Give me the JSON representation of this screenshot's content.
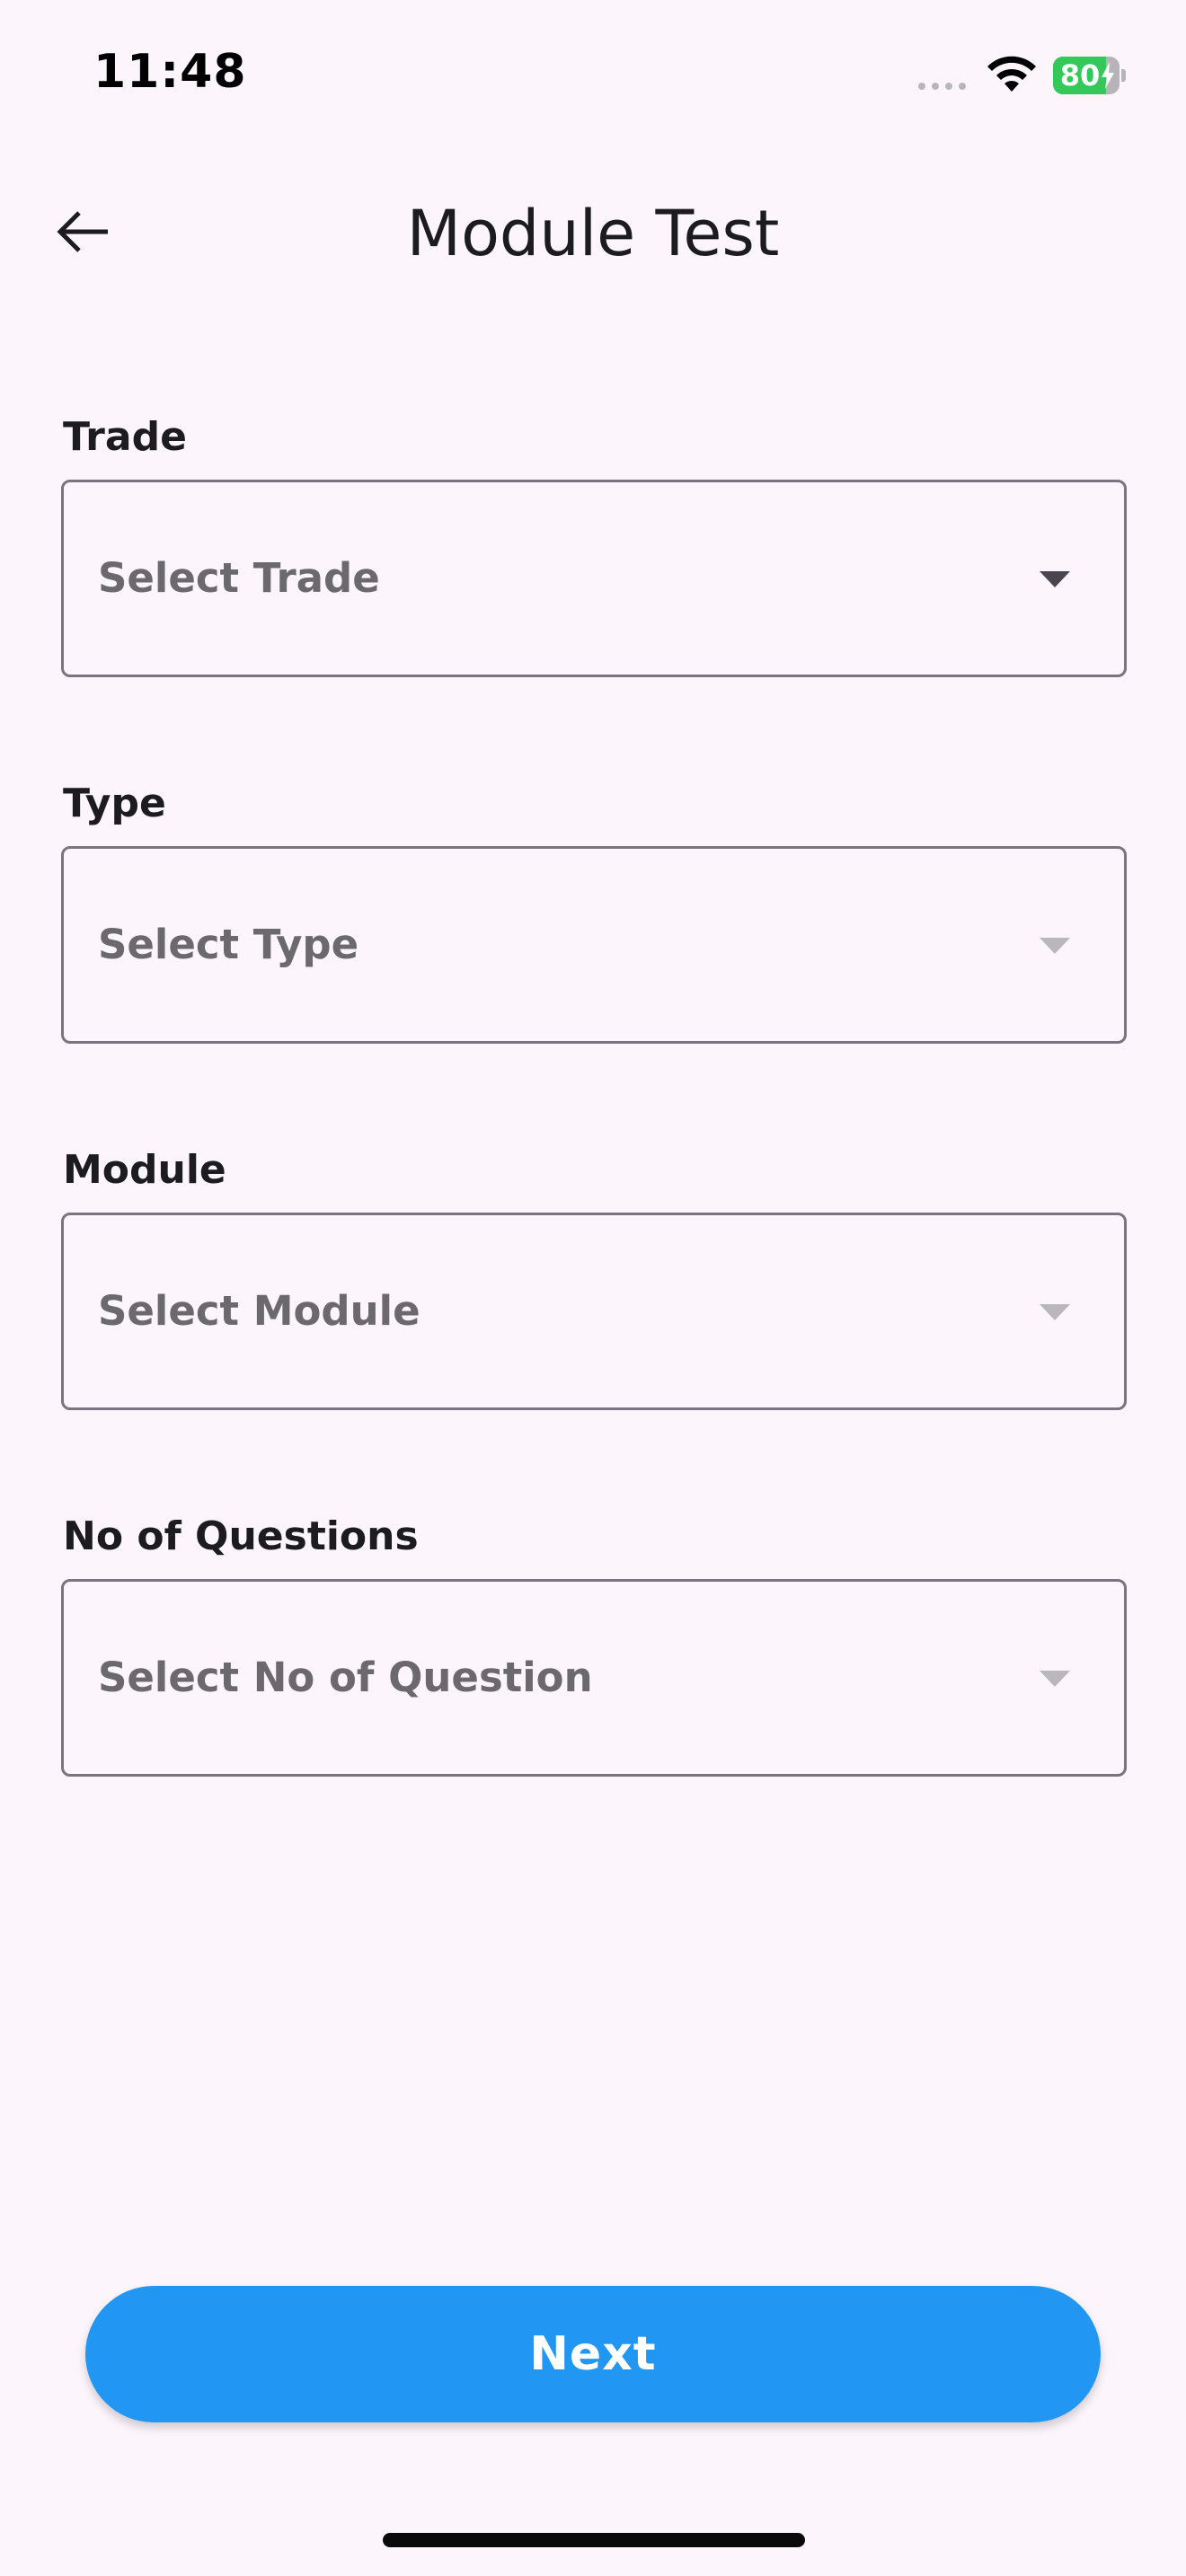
{
  "status_bar": {
    "time": "11:48",
    "battery_percent": "80",
    "battery_level": 0.8,
    "battery_color": "#34C759"
  },
  "app_bar": {
    "title": "Module Test",
    "back_icon": "arrow-back-icon"
  },
  "form": {
    "fields": [
      {
        "label": "Trade",
        "placeholder": "Select Trade",
        "enabled": true
      },
      {
        "label": "Type",
        "placeholder": "Select Type",
        "enabled": false
      },
      {
        "label": "Module",
        "placeholder": "Select Module",
        "enabled": false
      },
      {
        "label": "No of Questions",
        "placeholder": "Select No of Question",
        "enabled": false
      }
    ],
    "dropdown_icon": "arrow-drop-down-icon"
  },
  "actions": {
    "next_label": "Next",
    "next_color": "#2196F3"
  },
  "colors": {
    "background": "#FCF6FC",
    "outline": "#79747E",
    "placeholder_text": "#6B696E",
    "arrow_enabled": "#49454F",
    "arrow_disabled": "#B9B6BC"
  }
}
